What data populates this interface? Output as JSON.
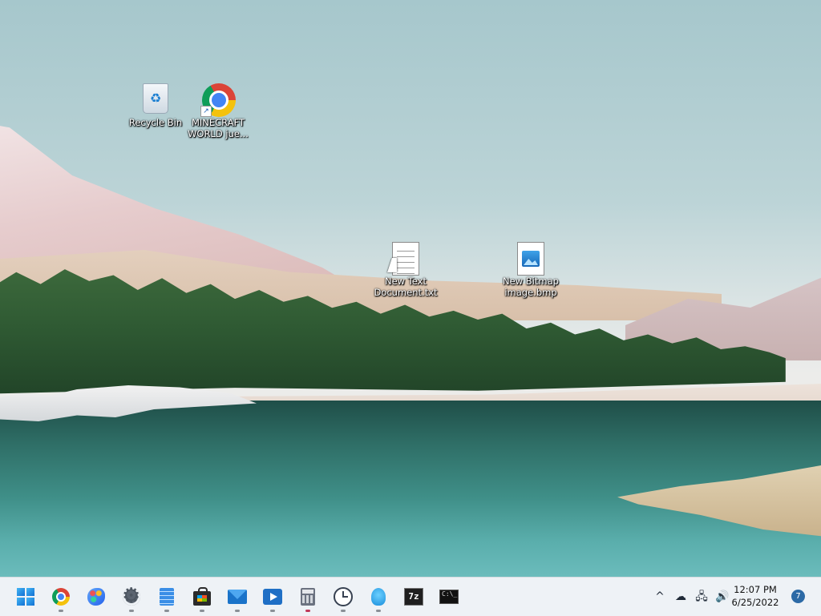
{
  "desktop": {
    "icons": [
      {
        "label": "Recycle Bin",
        "icon": "recycle-bin-icon"
      },
      {
        "label": "MINECRAFT\nWORLD jue...",
        "icon": "chrome-shortcut-icon"
      },
      {
        "label": "New Text\nDocument.txt",
        "icon": "text-document-icon"
      },
      {
        "label": "New Bitmap\nimage.bmp",
        "icon": "bitmap-image-icon"
      }
    ]
  },
  "taskbar": {
    "apps": [
      {
        "name": "Start",
        "icon": "windows-start-icon"
      },
      {
        "name": "Google Chrome",
        "icon": "chrome-icon",
        "running": true
      },
      {
        "name": "Paint",
        "icon": "paint-icon",
        "running": false
      },
      {
        "name": "Settings",
        "icon": "settings-gear-icon",
        "running": true
      },
      {
        "name": "Notepad",
        "icon": "notepad-icon",
        "running": true
      },
      {
        "name": "Microsoft Store",
        "icon": "store-icon",
        "running": true
      },
      {
        "name": "Mail",
        "icon": "mail-icon",
        "running": true
      },
      {
        "name": "Movies & TV",
        "icon": "movies-icon",
        "running": true
      },
      {
        "name": "Calculator",
        "icon": "calculator-icon",
        "running": true
      },
      {
        "name": "Clock",
        "icon": "clock-icon",
        "running": true
      },
      {
        "name": "Tips",
        "icon": "tips-icon",
        "running": true
      },
      {
        "name": "7-Zip",
        "icon": "7zip-icon",
        "running": false
      },
      {
        "name": "Terminal",
        "icon": "terminal-icon",
        "running": false
      }
    ],
    "tray": {
      "overflow": "^",
      "time": "12:07 PM",
      "date": "6/25/2022",
      "notifications": "7"
    },
    "text": {
      "sevenzip": "7z",
      "terminal": "C:\\_"
    }
  },
  "colors": {
    "taskbar_bg": "#eef2f6",
    "accent": "#1170d3",
    "badge": "#2c6aa6"
  }
}
